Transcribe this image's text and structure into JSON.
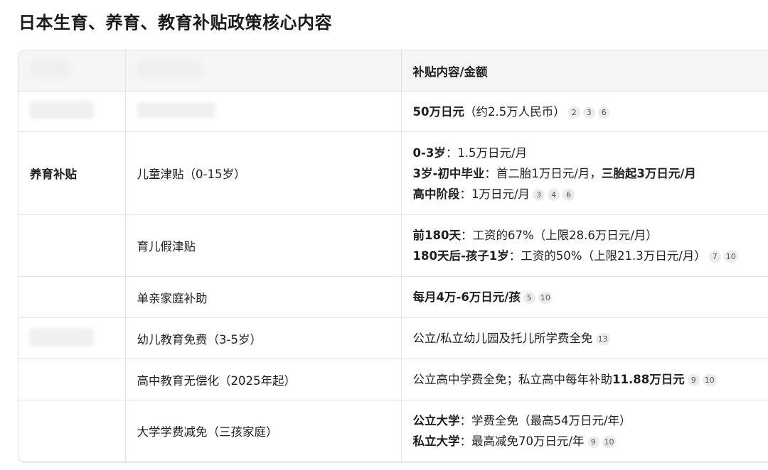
{
  "title": "日本生育、养育、教育补贴政策核心内容",
  "table": {
    "header": {
      "col1": "",
      "col2": "",
      "col3": "补贴内容/金额"
    },
    "rows": [
      {
        "category": "",
        "item": "",
        "lines": [
          {
            "segments": [
              {
                "text": "50万日元",
                "bold": true
              },
              {
                "text": "（约2.5万人民币）",
                "bold": false
              }
            ],
            "cites": [
              "2",
              "3",
              "6"
            ]
          }
        ]
      },
      {
        "category": "养育补贴",
        "item": "儿童津贴（0-15岁）",
        "lines": [
          {
            "segments": [
              {
                "text": "0-3岁",
                "bold": true
              },
              {
                "text": "：1.5万日元/月",
                "bold": false
              }
            ],
            "cites": []
          },
          {
            "segments": [
              {
                "text": "3岁-初中毕业",
                "bold": true
              },
              {
                "text": "：首二胎1万日元/月，",
                "bold": false
              },
              {
                "text": "三胎起3万日元/月",
                "bold": true
              }
            ],
            "cites": []
          },
          {
            "segments": [
              {
                "text": "高中阶段",
                "bold": true
              },
              {
                "text": "：1万日元/月",
                "bold": false
              }
            ],
            "cites": [
              "3",
              "4",
              "6"
            ]
          }
        ]
      },
      {
        "category": "",
        "item": "育儿假津贴",
        "lines": [
          {
            "segments": [
              {
                "text": "前180天",
                "bold": true
              },
              {
                "text": "：工资的67%（上限28.6万日元/月）",
                "bold": false
              }
            ],
            "cites": []
          },
          {
            "segments": [
              {
                "text": "180天后-孩子1岁",
                "bold": true
              },
              {
                "text": "：工资的50%（上限21.3万日元/月）",
                "bold": false
              }
            ],
            "cites": [
              "7",
              "10"
            ]
          }
        ]
      },
      {
        "category": "",
        "item": "单亲家庭补助",
        "lines": [
          {
            "segments": [
              {
                "text": "每月4万-6万日元/孩",
                "bold": true
              }
            ],
            "cites": [
              "5",
              "10"
            ]
          }
        ]
      },
      {
        "category": "",
        "item": "幼儿教育免费（3-5岁）",
        "lines": [
          {
            "segments": [
              {
                "text": "公立/私立幼儿园及托儿所学费全免",
                "bold": false
              }
            ],
            "cites": [
              "13"
            ]
          }
        ]
      },
      {
        "category": "",
        "item": "高中教育无偿化（2025年起）",
        "lines": [
          {
            "segments": [
              {
                "text": "公立高中学费全免；私立高中每年补助",
                "bold": false
              },
              {
                "text": "11.88万日元",
                "bold": true
              }
            ],
            "cites": [
              "9",
              "10"
            ]
          }
        ]
      },
      {
        "category": "",
        "item": "大学学费减免（三孩家庭）",
        "lines": [
          {
            "segments": [
              {
                "text": "公立大学",
                "bold": true
              },
              {
                "text": "：学费全免（最高54万日元/年）",
                "bold": false
              }
            ],
            "cites": []
          },
          {
            "segments": [
              {
                "text": "私立大学",
                "bold": true
              },
              {
                "text": "：最高减免70万日元/年",
                "bold": false
              }
            ],
            "cites": [
              "9",
              "10"
            ]
          }
        ]
      }
    ]
  }
}
